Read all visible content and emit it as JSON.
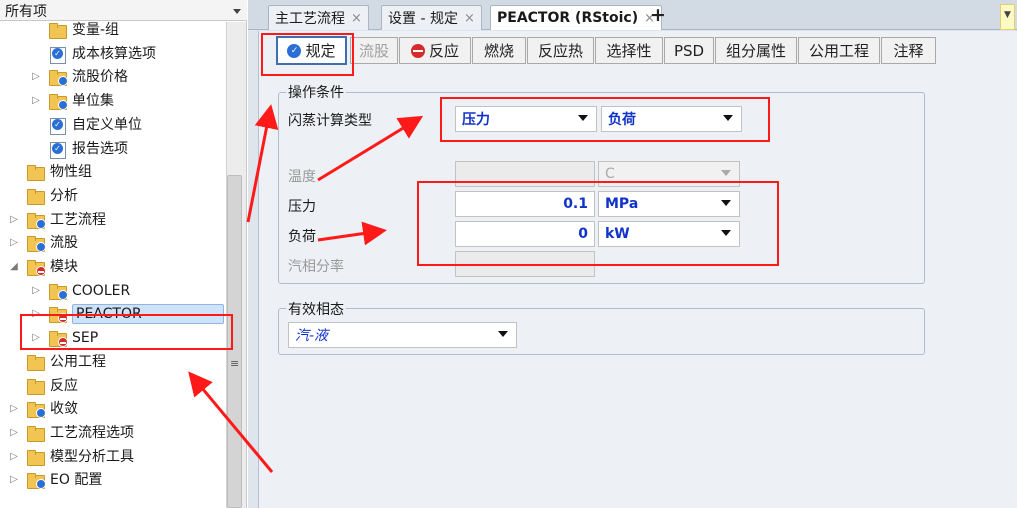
{
  "nav": {
    "header_label": "所有项",
    "items": [
      {
        "label": "变量-组",
        "icon": "folder-icon",
        "expander": ""
      },
      {
        "label": "成本核算选项",
        "icon": "form-check-icon",
        "expander": ""
      },
      {
        "label": "流股价格",
        "icon": "folder-check-icon",
        "expander": "▷"
      },
      {
        "label": "单位集",
        "icon": "folder-check-icon",
        "expander": "▷"
      },
      {
        "label": "自定义单位",
        "icon": "form-check-icon",
        "expander": ""
      },
      {
        "label": "报告选项",
        "icon": "form-check-icon",
        "expander": ""
      },
      {
        "label": "物性组",
        "icon": "folder-icon",
        "expander": ""
      },
      {
        "label": "分析",
        "icon": "folder-icon",
        "expander": ""
      },
      {
        "label": "工艺流程",
        "icon": "folder-check-icon",
        "expander": "▷"
      },
      {
        "label": "流股",
        "icon": "folder-check-icon",
        "expander": "▷"
      },
      {
        "label": "模块",
        "icon": "folder-error-icon",
        "expander": "◢"
      },
      {
        "label": "COOLER",
        "icon": "folder-check-icon",
        "expander": "▷"
      },
      {
        "label": "PEACTOR",
        "icon": "folder-error-icon",
        "expander": "▷"
      },
      {
        "label": "SEP",
        "icon": "folder-error-icon",
        "expander": "▷"
      },
      {
        "label": "公用工程",
        "icon": "folder-icon",
        "expander": ""
      },
      {
        "label": "反应",
        "icon": "folder-icon",
        "expander": ""
      },
      {
        "label": "收敛",
        "icon": "folder-check-icon",
        "expander": "▷"
      },
      {
        "label": "工艺流程选项",
        "icon": "folder-icon",
        "expander": "▷"
      },
      {
        "label": "模型分析工具",
        "icon": "folder-icon",
        "expander": "▷"
      },
      {
        "label": "EO 配置",
        "icon": "folder-check-icon",
        "expander": "▷"
      }
    ]
  },
  "doc_tabs": [
    {
      "label": "主工艺流程",
      "close": "×"
    },
    {
      "label": "设置 - 规定",
      "close": "×"
    },
    {
      "label": "PEACTOR (RStoic)",
      "close": "×"
    }
  ],
  "doc_tab_add": "+",
  "form_tabs": [
    {
      "label": "规定",
      "state": "ok"
    },
    {
      "label": "流股",
      "state": "disabled"
    },
    {
      "label": "反应",
      "state": "error"
    },
    {
      "label": "燃烧",
      "state": "none"
    },
    {
      "label": "反应热",
      "state": "none"
    },
    {
      "label": "选择性",
      "state": "none"
    },
    {
      "label": "PSD",
      "state": "none"
    },
    {
      "label": "组分属性",
      "state": "none"
    },
    {
      "label": "公用工程",
      "state": "none"
    },
    {
      "label": "注释",
      "state": "none"
    }
  ],
  "operating": {
    "legend": "操作条件",
    "flash_type_label": "闪蒸计算类型",
    "flash_spec1": "压力",
    "flash_spec2": "负荷",
    "temp_label": "温度",
    "temp_value": "",
    "temp_unit": "C",
    "pressure_label": "压力",
    "pressure_value": "0.1",
    "pressure_unit": "MPa",
    "duty_label": "负荷",
    "duty_value": "0",
    "duty_unit": "kW",
    "vapor_frac_label": "汽相分率",
    "vapor_frac_value": ""
  },
  "phases": {
    "legend": "有效相态",
    "value": "汽-液"
  },
  "colors": {
    "accent_blue": "#1033c9",
    "annotation_red": "#ff1a1a",
    "status_ok": "#2b6fd6",
    "status_error": "#d62b2b"
  }
}
